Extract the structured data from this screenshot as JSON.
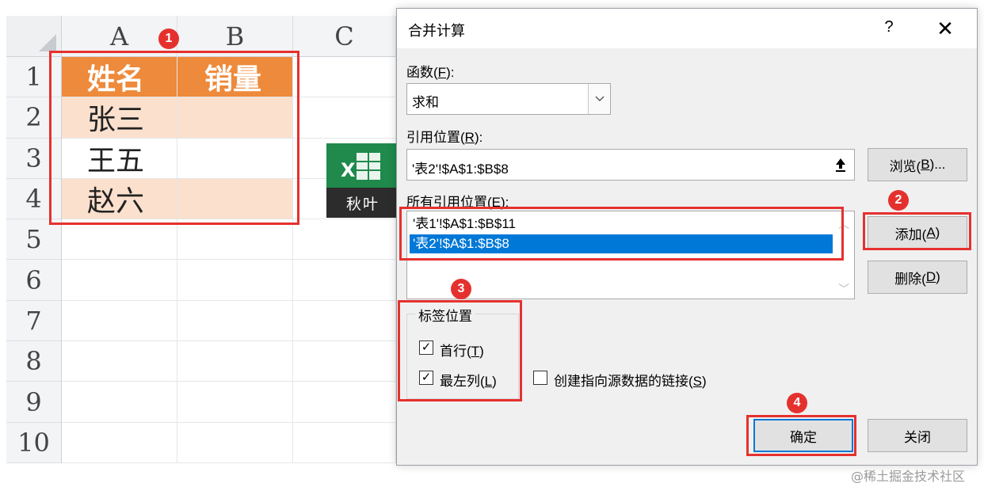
{
  "spreadsheet": {
    "columns": [
      "A",
      "B",
      "C"
    ],
    "rows": [
      "1",
      "2",
      "3",
      "4",
      "5",
      "6",
      "7",
      "8",
      "9",
      "10"
    ],
    "header_row": {
      "name": "姓名",
      "sales": "销量"
    },
    "data_rows": [
      {
        "name": "张三",
        "sales": ""
      },
      {
        "name": "王五",
        "sales": ""
      },
      {
        "name": "赵六",
        "sales": ""
      }
    ],
    "colors": {
      "header_fill": "#ee8a3b",
      "band_fill": "#fbe0cd",
      "highlight_box": "#e5312e"
    }
  },
  "logo": {
    "caption": "秋叶",
    "icon": "excel-logo-icon"
  },
  "dialog": {
    "title": "合并计算",
    "help_label": "?",
    "close_label": "✕",
    "function_label": "函数(",
    "function_key": "F",
    "function_suffix": "):",
    "function_value": "求和",
    "reference_label": "引用位置(",
    "reference_key": "R",
    "reference_suffix": "):",
    "reference_value": "'表2'!$A$1:$B$8",
    "browse_label": "浏览(",
    "browse_key": "B",
    "browse_suffix": ")...",
    "all_refs_label": "所有引用位置(",
    "all_refs_key": "E",
    "all_refs_suffix": "):",
    "all_refs": [
      {
        "value": "'表1'!$A$1:$B$11",
        "selected": false
      },
      {
        "value": "'表2'!$A$1:$B$8",
        "selected": true
      }
    ],
    "add_label": "添加(",
    "add_key": "A",
    "add_suffix": ")",
    "delete_label": "删除(",
    "delete_key": "D",
    "delete_suffix": ")",
    "label_position_title": "标签位置",
    "top_row": {
      "label": "首行(",
      "key": "T",
      "suffix": ")",
      "checked": true
    },
    "left_column": {
      "label": "最左列(",
      "key": "L",
      "suffix": ")",
      "checked": true
    },
    "create_links": {
      "label": "创建指向源数据的链接(",
      "key": "S",
      "suffix": ")",
      "checked": false
    },
    "ok_label": "确定",
    "close_button_label": "关闭",
    "check_mark": "✓",
    "selection_color": "#0078d7"
  },
  "badges": [
    "1",
    "2",
    "3",
    "4"
  ],
  "watermark": "@稀土掘金技术社区"
}
